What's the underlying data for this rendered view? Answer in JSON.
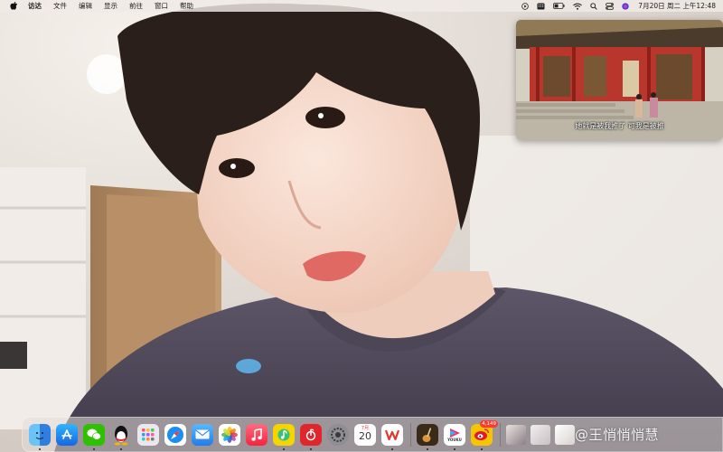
{
  "menubar": {
    "apple_icon": "apple-logo-icon",
    "items": [
      "访达",
      "文件",
      "编辑",
      "显示",
      "前往",
      "窗口",
      "帮助"
    ],
    "status_icons": [
      "play-icon",
      "keyboard-icon",
      "battery-icon",
      "wifi-icon",
      "search-icon",
      "control-center-icon",
      "siri-icon"
    ],
    "clock": "7月20日 周二 上午12:48"
  },
  "pip": {
    "subtitle": "她就是被我推了  可我是被推"
  },
  "dock": {
    "apps": [
      {
        "name": "finder-icon",
        "color": "#3a8ee6"
      },
      {
        "name": "app-store-icon",
        "color": "#1e88f0"
      },
      {
        "name": "wechat-icon",
        "color": "#2dc100"
      },
      {
        "name": "qq-icon",
        "color": "#ffffff"
      },
      {
        "name": "launchpad-icon",
        "color": "#e8e8ee"
      },
      {
        "name": "safari-icon",
        "color": "#1a8ef2"
      },
      {
        "name": "mail-icon",
        "color": "#3a9af5"
      },
      {
        "name": "photos-icon",
        "color": "#ffffff"
      },
      {
        "name": "music-icon",
        "color": "#fa3f55"
      },
      {
        "name": "qq-music-icon",
        "color": "#f5d400"
      },
      {
        "name": "netease-music-icon",
        "color": "#e0262a"
      },
      {
        "name": "system-preferences-icon",
        "color": "#8e8e93"
      },
      {
        "name": "calendar-icon",
        "color": "#ffffff"
      },
      {
        "name": "wps-office-icon",
        "color": "#ffffff"
      },
      {
        "name": "guitar-icon",
        "color": "#3a2a1a"
      },
      {
        "name": "youku-icon",
        "color": "#ffffff"
      },
      {
        "name": "weibo-icon",
        "color": "#f5c600"
      }
    ],
    "calendar": {
      "month": "7月",
      "day": "20"
    },
    "youku_label": "YOUKU",
    "weibo_badge": "4,149"
  },
  "watermark": "@王悄悄悄慧"
}
